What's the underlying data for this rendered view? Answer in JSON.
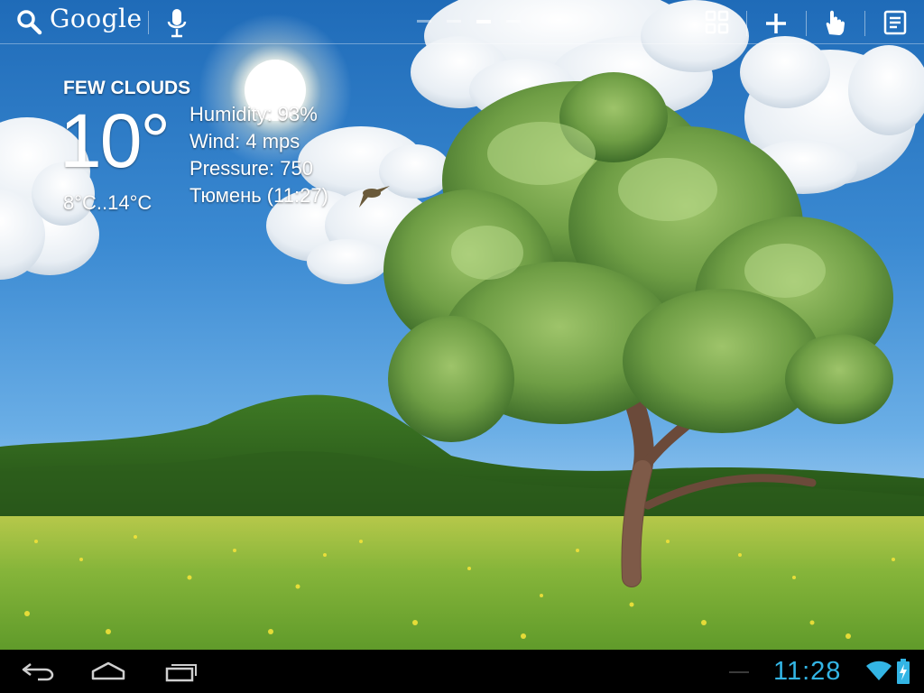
{
  "top_bar": {
    "search_label": "Google",
    "search_icon": "search-icon",
    "voice_icon": "microphone-icon",
    "page_indicator": {
      "count": 4,
      "active_index": 2
    },
    "actions": [
      {
        "name": "apps-grid-button",
        "icon": "grid-icon"
      },
      {
        "name": "add-widget-button",
        "icon": "plus-icon"
      },
      {
        "name": "touch-gesture-button",
        "icon": "hand-icon"
      },
      {
        "name": "notes-button",
        "icon": "notes-icon"
      }
    ]
  },
  "weather": {
    "condition": "FEW CLOUDS",
    "temperature": "10°",
    "range": "8°C..14°C",
    "humidity": "Humidity: 93%",
    "wind": "Wind: 4 mps",
    "pressure": "Pressure: 750",
    "location_time": "Тюмень (11:27)"
  },
  "nav_bar": {
    "back_icon": "back-icon",
    "home_icon": "home-icon",
    "recents_icon": "recent-apps-icon",
    "clock": "11:28",
    "wifi_icon": "wifi-icon",
    "battery_icon": "battery-charging-icon"
  },
  "colors": {
    "sky_top": "#1f6bb8",
    "sky_bottom": "#8fc3ee",
    "field": "#7fb23a",
    "clock_accent": "#33b5e5"
  }
}
